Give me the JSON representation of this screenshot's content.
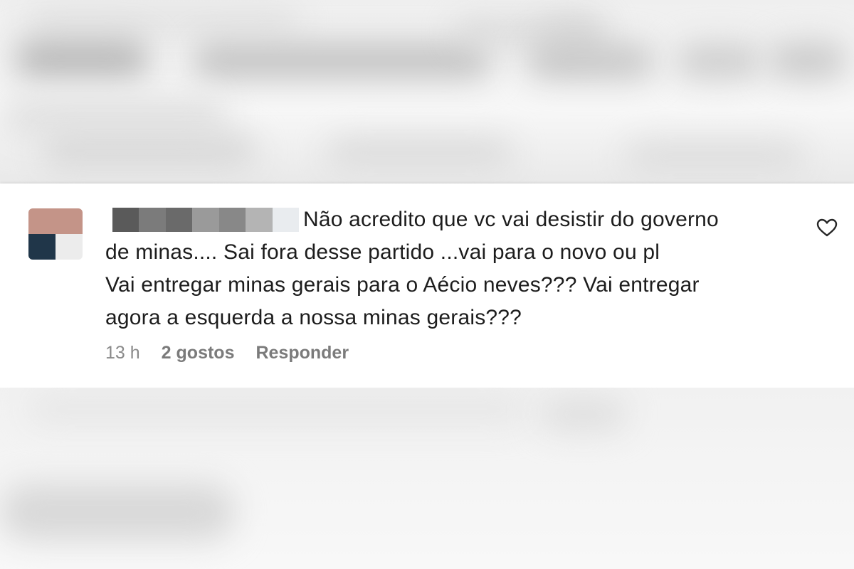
{
  "comment": {
    "text_line1": "Não acredito que vc vai desistir do governo",
    "text_line2": "de minas.... Sai fora desse partido ...vai para o novo ou pl",
    "text_line3": "Vai entregar minas gerais para o Aécio neves??? Vai entregar",
    "text_line4": "agora a esquerda a nossa minas gerais???",
    "time": "13 h",
    "likes": "2 gostos",
    "reply_label": "Responder",
    "like_icon": "heart-outline-icon"
  },
  "colors": {
    "text": "#1d1d1d",
    "meta": "#7a7a7a",
    "card_bg": "#ffffff"
  }
}
